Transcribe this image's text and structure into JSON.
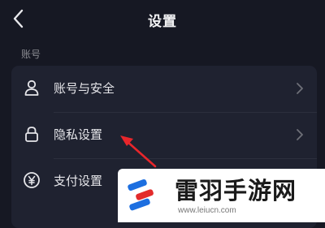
{
  "header": {
    "title": "设置",
    "back_icon": "chevron-left-icon"
  },
  "section": {
    "label": "账号"
  },
  "rows": [
    {
      "label": "账号与安全",
      "icon": "user-icon"
    },
    {
      "label": "隐私设置",
      "icon": "lock-icon"
    },
    {
      "label": "支付设置",
      "icon": "yen-icon"
    }
  ],
  "watermark": {
    "name": "雷羽手游网",
    "url": "www.leiucn.com"
  },
  "colors": {
    "background": "#161823",
    "card": "#1f2230",
    "annotation_arrow": "#e8262b",
    "logo_blue": "#1d6fe0",
    "logo_red": "#e32b2b"
  }
}
